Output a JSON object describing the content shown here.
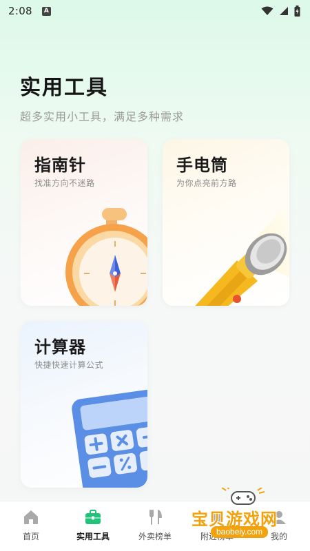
{
  "status": {
    "time": "2:08",
    "notification_badge": "A"
  },
  "header": {
    "title": "实用工具",
    "subtitle": "超多实用小工具，满足多种需求"
  },
  "tools": [
    {
      "title": "指南针",
      "desc": "找准方向不迷路",
      "icon": "compass-icon"
    },
    {
      "title": "手电筒",
      "desc": "为你点亮前方路",
      "icon": "flashlight-icon"
    },
    {
      "title": "计算器",
      "desc": "快捷快速计算公式",
      "icon": "calculator-icon"
    }
  ],
  "tabs": [
    {
      "label": "首页",
      "icon": "home-icon",
      "active": false
    },
    {
      "label": "实用工具",
      "icon": "toolbox-icon",
      "active": true
    },
    {
      "label": "外卖榜单",
      "icon": "utensils-icon",
      "active": false
    },
    {
      "label": "附近榜单",
      "icon": "list-icon",
      "active": false
    },
    {
      "label": "我的",
      "icon": "user-icon",
      "active": false
    }
  ],
  "watermark": {
    "text": "宝贝游戏网",
    "url": "baobeiy.com"
  },
  "colors": {
    "accent": "#21c27a",
    "watermark": "#f2a20d"
  }
}
